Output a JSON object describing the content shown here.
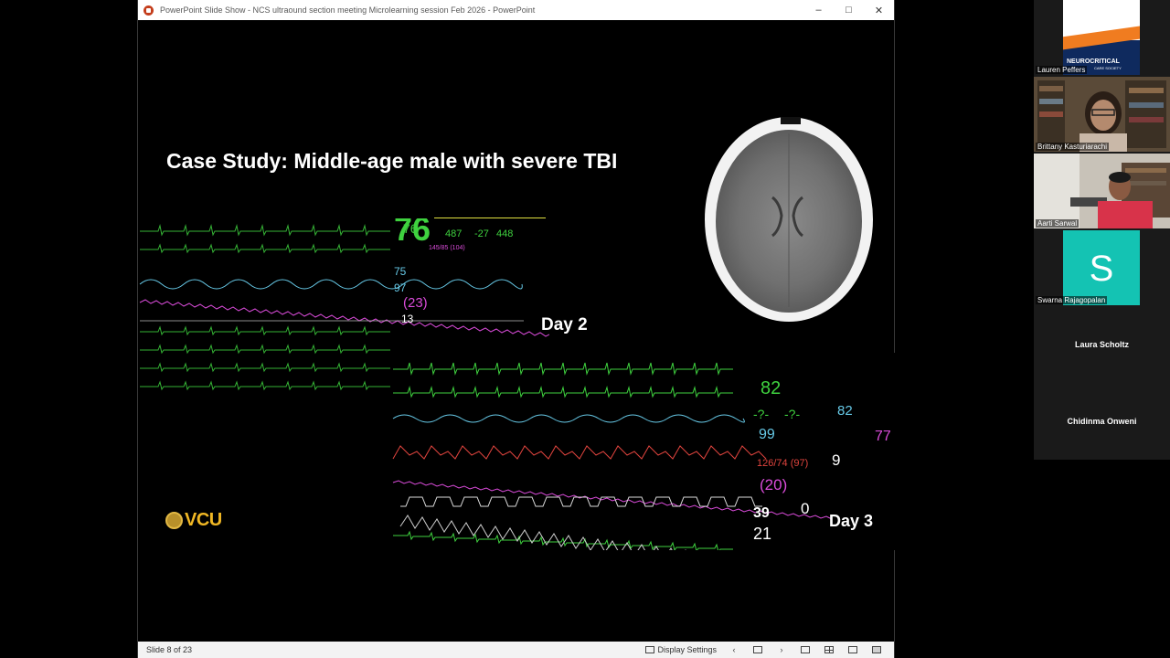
{
  "window": {
    "title": "PowerPoint Slide Show  -  NCS ultraound section meeting Microlearning session Feb 2026 - PowerPoint",
    "minimize_icon": "minimize-icon",
    "restore_icon": "restore-icon",
    "close_icon": "close-icon"
  },
  "slide": {
    "title": "Case Study: Middle-age male with severe TBI",
    "day2_label": "Day 2",
    "day3_label": "Day 3",
    "logo_text": "VCU"
  },
  "monitor_day2": {
    "hr": "76",
    "pulse": "75",
    "spo2": "97",
    "icp": "(23)",
    "rr": "13",
    "top_values": [
      "487",
      "-27",
      "448"
    ],
    "nbp": "145/85 (104)"
  },
  "monitor_day3": {
    "hr": "82",
    "st_a": "-?-",
    "st_b": "-?-",
    "spo2": "99",
    "pulse": "82",
    "cpp": "77",
    "abp": "126/74 (97)",
    "icp": "(20)",
    "psi": "9",
    "etco2": "39",
    "imco2": "0",
    "rr": "21"
  },
  "statusbar": {
    "slide_counter": "Slide 8 of 23",
    "display_settings": "Display Settings"
  },
  "participants": [
    {
      "name": "Lauren Peffers",
      "logo_text_1": "NEUROCRITICAL",
      "logo_text_2": "CARE SOCIETY"
    },
    {
      "name": "Brittany Kasturiarachi"
    },
    {
      "name": "Aarti Sarwal"
    },
    {
      "name": "Swarna Rajagopalan",
      "initial": "S"
    },
    {
      "name": "Laura Scholtz"
    },
    {
      "name": "Chidinma Onweni"
    }
  ],
  "colors": {
    "ecg_green": "#3fd23f",
    "spo2_cyan": "#66c8e6",
    "icp_magenta": "#d94bd9",
    "abp_red": "#e0443e",
    "avatar_teal": "#14c3b3",
    "vcu_gold": "#f0b724"
  }
}
